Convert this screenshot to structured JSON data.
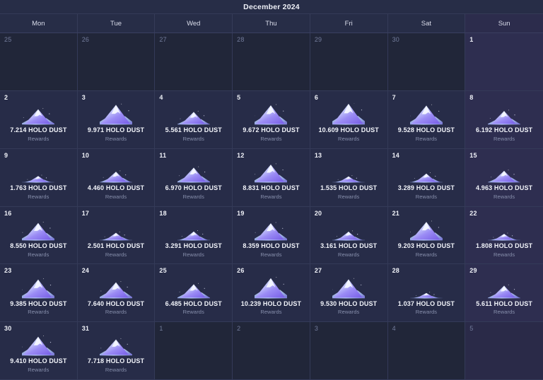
{
  "header": {
    "title": "December 2024",
    "weekdays": [
      {
        "label": "Mon",
        "weekend": false
      },
      {
        "label": "Tue",
        "weekend": false
      },
      {
        "label": "Wed",
        "weekend": false
      },
      {
        "label": "Thu",
        "weekend": false
      },
      {
        "label": "Fri",
        "weekend": false
      },
      {
        "label": "Sat",
        "weekend": false
      },
      {
        "label": "Sun",
        "weekend": true
      }
    ]
  },
  "labels": {
    "reward_sublabel": "Rewards",
    "currency": "HOLO DUST",
    "icon_name": "holo-dust-mountain-icon"
  },
  "colors": {
    "title_bar_bg": "#272d47",
    "weekday_bg": "#272d47",
    "cell_in_month_bg": "#272c48",
    "cell_in_month_weekend_bg": "#2e2e50",
    "cell_out_month_bg": "#212639",
    "cell_out_month_weekend_bg": "#2a2a48",
    "grid_line": "#343a58",
    "day_number": "#f0f2f8",
    "day_number_muted": "#737c9c",
    "amount_text": "#f2f4fa",
    "sub_text": "#8890ad",
    "icon_peak": "#ffffff",
    "icon_mid": "#a9b6f2",
    "icon_purple": "#8b6cf0",
    "icon_cyan": "#b6e6e8"
  },
  "calendar": {
    "max_value": 10.609,
    "weeks": [
      [
        {
          "day": "25",
          "in_month": false,
          "weekend": false,
          "value": null
        },
        {
          "day": "26",
          "in_month": false,
          "weekend": false,
          "value": null
        },
        {
          "day": "27",
          "in_month": false,
          "weekend": false,
          "value": null
        },
        {
          "day": "28",
          "in_month": false,
          "weekend": false,
          "value": null
        },
        {
          "day": "29",
          "in_month": false,
          "weekend": false,
          "value": null
        },
        {
          "day": "30",
          "in_month": false,
          "weekend": false,
          "value": null
        },
        {
          "day": "1",
          "in_month": true,
          "weekend": true,
          "value": null
        }
      ],
      [
        {
          "day": "2",
          "in_month": true,
          "weekend": false,
          "value": "7.214",
          "amount": "7.214 HOLO DUST",
          "num": 7.214
        },
        {
          "day": "3",
          "in_month": true,
          "weekend": false,
          "value": "9.971",
          "amount": "9.971 HOLO DUST",
          "num": 9.971
        },
        {
          "day": "4",
          "in_month": true,
          "weekend": false,
          "value": "5.561",
          "amount": "5.561 HOLO DUST",
          "num": 5.561
        },
        {
          "day": "5",
          "in_month": true,
          "weekend": false,
          "value": "9.672",
          "amount": "9.672 HOLO DUST",
          "num": 9.672
        },
        {
          "day": "6",
          "in_month": true,
          "weekend": false,
          "value": "10.609",
          "amount": "10.609 HOLO DUST",
          "num": 10.609
        },
        {
          "day": "7",
          "in_month": true,
          "weekend": false,
          "value": "9.528",
          "amount": "9.528 HOLO DUST",
          "num": 9.528
        },
        {
          "day": "8",
          "in_month": true,
          "weekend": true,
          "value": "6.192",
          "amount": "6.192 HOLO DUST",
          "num": 6.192
        }
      ],
      [
        {
          "day": "9",
          "in_month": true,
          "weekend": false,
          "value": "1.763",
          "amount": "1.763 HOLO DUST",
          "num": 1.763
        },
        {
          "day": "10",
          "in_month": true,
          "weekend": false,
          "value": "4.460",
          "amount": "4.460 HOLO DUST",
          "num": 4.46
        },
        {
          "day": "11",
          "in_month": true,
          "weekend": false,
          "value": "6.970",
          "amount": "6.970 HOLO DUST",
          "num": 6.97
        },
        {
          "day": "12",
          "in_month": true,
          "weekend": false,
          "value": "8.831",
          "amount": "8.831 HOLO DUST",
          "num": 8.831
        },
        {
          "day": "13",
          "in_month": true,
          "weekend": false,
          "value": "1.535",
          "amount": "1.535 HOLO DUST",
          "num": 1.535
        },
        {
          "day": "14",
          "in_month": true,
          "weekend": false,
          "value": "3.289",
          "amount": "3.289 HOLO DUST",
          "num": 3.289
        },
        {
          "day": "15",
          "in_month": true,
          "weekend": true,
          "value": "4.963",
          "amount": "4.963 HOLO DUST",
          "num": 4.963
        }
      ],
      [
        {
          "day": "16",
          "in_month": true,
          "weekend": false,
          "value": "8.550",
          "amount": "8.550 HOLO DUST",
          "num": 8.55
        },
        {
          "day": "17",
          "in_month": true,
          "weekend": false,
          "value": "2.501",
          "amount": "2.501 HOLO DUST",
          "num": 2.501
        },
        {
          "day": "18",
          "in_month": true,
          "weekend": false,
          "value": "3.291",
          "amount": "3.291 HOLO DUST",
          "num": 3.291
        },
        {
          "day": "19",
          "in_month": true,
          "weekend": false,
          "value": "8.359",
          "amount": "8.359 HOLO DUST",
          "num": 8.359
        },
        {
          "day": "20",
          "in_month": true,
          "weekend": false,
          "value": "3.161",
          "amount": "3.161 HOLO DUST",
          "num": 3.161
        },
        {
          "day": "21",
          "in_month": true,
          "weekend": false,
          "value": "9.203",
          "amount": "9.203 HOLO DUST",
          "num": 9.203
        },
        {
          "day": "22",
          "in_month": true,
          "weekend": true,
          "value": "1.808",
          "amount": "1.808 HOLO DUST",
          "num": 1.808
        }
      ],
      [
        {
          "day": "23",
          "in_month": true,
          "weekend": false,
          "value": "9.385",
          "amount": "9.385 HOLO DUST",
          "num": 9.385
        },
        {
          "day": "24",
          "in_month": true,
          "weekend": false,
          "value": "7.640",
          "amount": "7.640 HOLO DUST",
          "num": 7.64
        },
        {
          "day": "25",
          "in_month": true,
          "weekend": false,
          "value": "6.485",
          "amount": "6.485 HOLO DUST",
          "num": 6.485
        },
        {
          "day": "26",
          "in_month": true,
          "weekend": false,
          "value": "10.239",
          "amount": "10.239 HOLO DUST",
          "num": 10.239
        },
        {
          "day": "27",
          "in_month": true,
          "weekend": false,
          "value": "9.530",
          "amount": "9.530 HOLO DUST",
          "num": 9.53
        },
        {
          "day": "28",
          "in_month": true,
          "weekend": false,
          "value": "1.037",
          "amount": "1.037 HOLO DUST",
          "num": 1.037
        },
        {
          "day": "29",
          "in_month": true,
          "weekend": true,
          "value": "5.611",
          "amount": "5.611 HOLO DUST",
          "num": 5.611
        }
      ],
      [
        {
          "day": "30",
          "in_month": true,
          "weekend": false,
          "value": "9.410",
          "amount": "9.410 HOLO DUST",
          "num": 9.41
        },
        {
          "day": "31",
          "in_month": true,
          "weekend": false,
          "value": "7.718",
          "amount": "7.718 HOLO DUST",
          "num": 7.718
        },
        {
          "day": "1",
          "in_month": false,
          "weekend": false,
          "value": null
        },
        {
          "day": "2",
          "in_month": false,
          "weekend": false,
          "value": null
        },
        {
          "day": "3",
          "in_month": false,
          "weekend": false,
          "value": null
        },
        {
          "day": "4",
          "in_month": false,
          "weekend": false,
          "value": null
        },
        {
          "day": "5",
          "in_month": false,
          "weekend": true,
          "value": null
        }
      ]
    ]
  }
}
